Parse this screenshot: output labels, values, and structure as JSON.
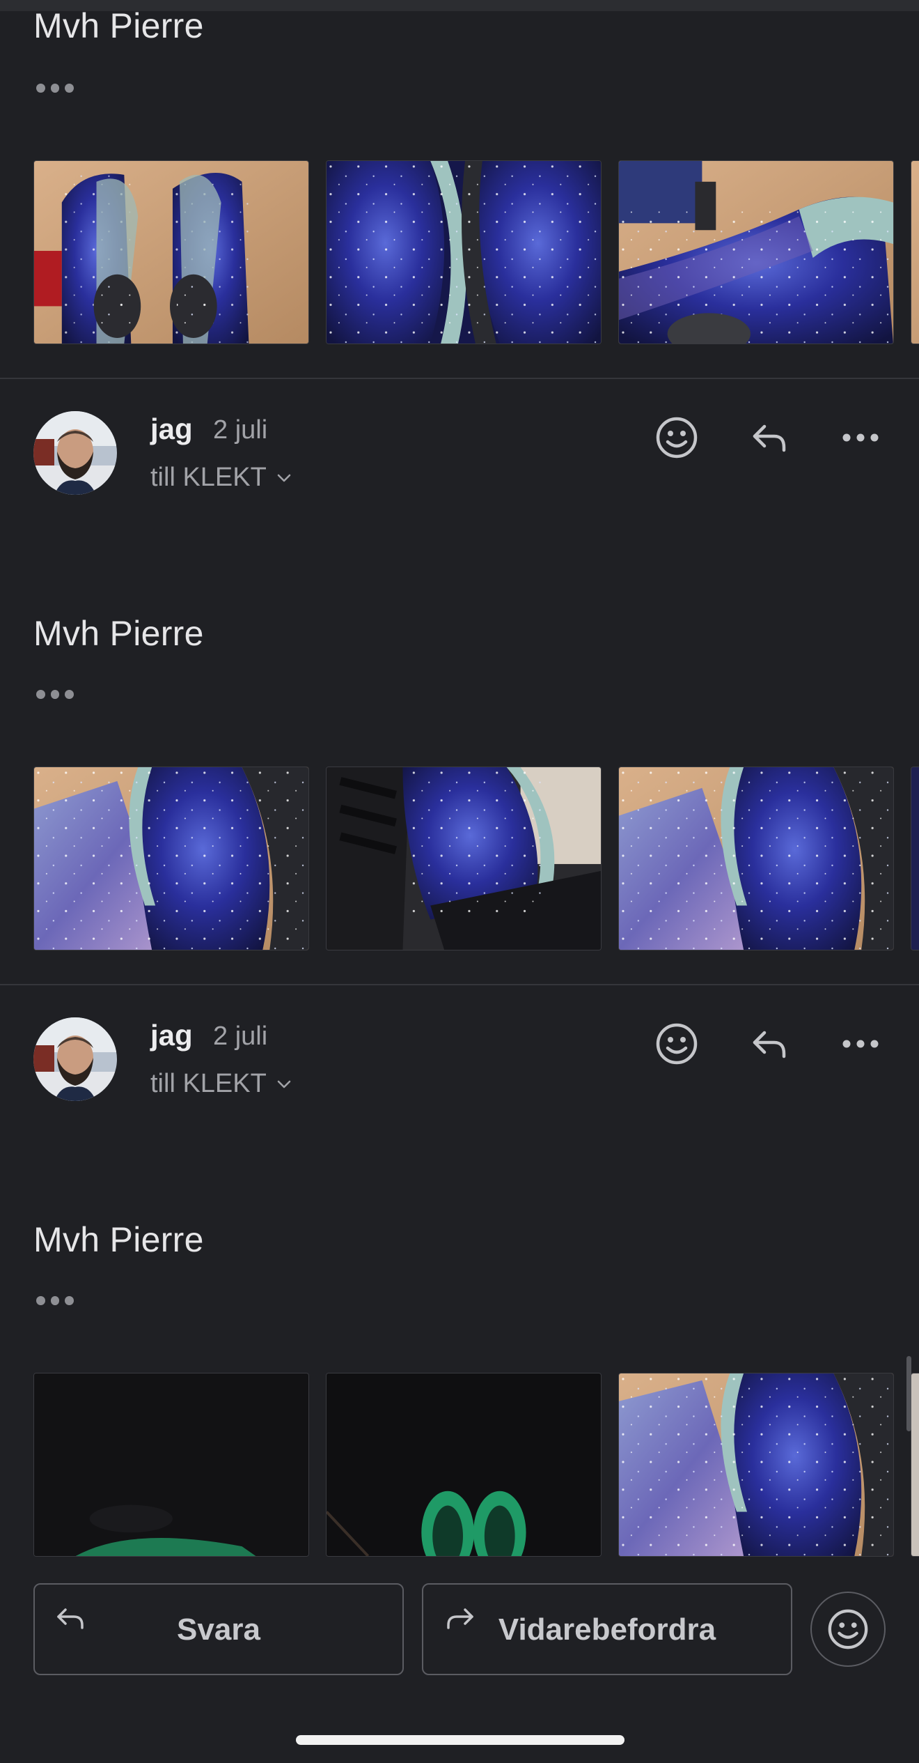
{
  "messages": [
    {
      "signoff": "Mvh Pierre",
      "attachments": [
        "sole-bottom-view",
        "galaxy-side-panel",
        "galaxy-shoe-on-table",
        "partial-thumb"
      ]
    },
    {
      "sender": "jag",
      "date": "2 juli",
      "recipient": "till KLEKT",
      "signoff": "Mvh Pierre",
      "attachments": [
        "galaxy-heel-box",
        "galaxy-laces-box",
        "galaxy-heel-closeup",
        "partial-thumb"
      ]
    },
    {
      "sender": "jag",
      "date": "2 juli",
      "recipient": "till KLEKT",
      "signoff": "Mvh Pierre",
      "attachments": [
        "dark-glow-sole",
        "dark-glow-pair",
        "galaxy-heel-box",
        "partial-thumb"
      ]
    }
  ],
  "header_actions": {
    "react_icon": "smiley-icon",
    "reply_icon": "reply-arrow-icon",
    "more_icon": "more-horizontal-icon"
  },
  "bottom_bar": {
    "reply_label": "Svara",
    "forward_label": "Vidarebefordra",
    "emoji_icon": "smiley-icon"
  },
  "colors": {
    "background": "#1f2024",
    "text_primary": "#e4e4e6",
    "text_secondary": "#a2a3a8",
    "border": "#5b5c62"
  }
}
